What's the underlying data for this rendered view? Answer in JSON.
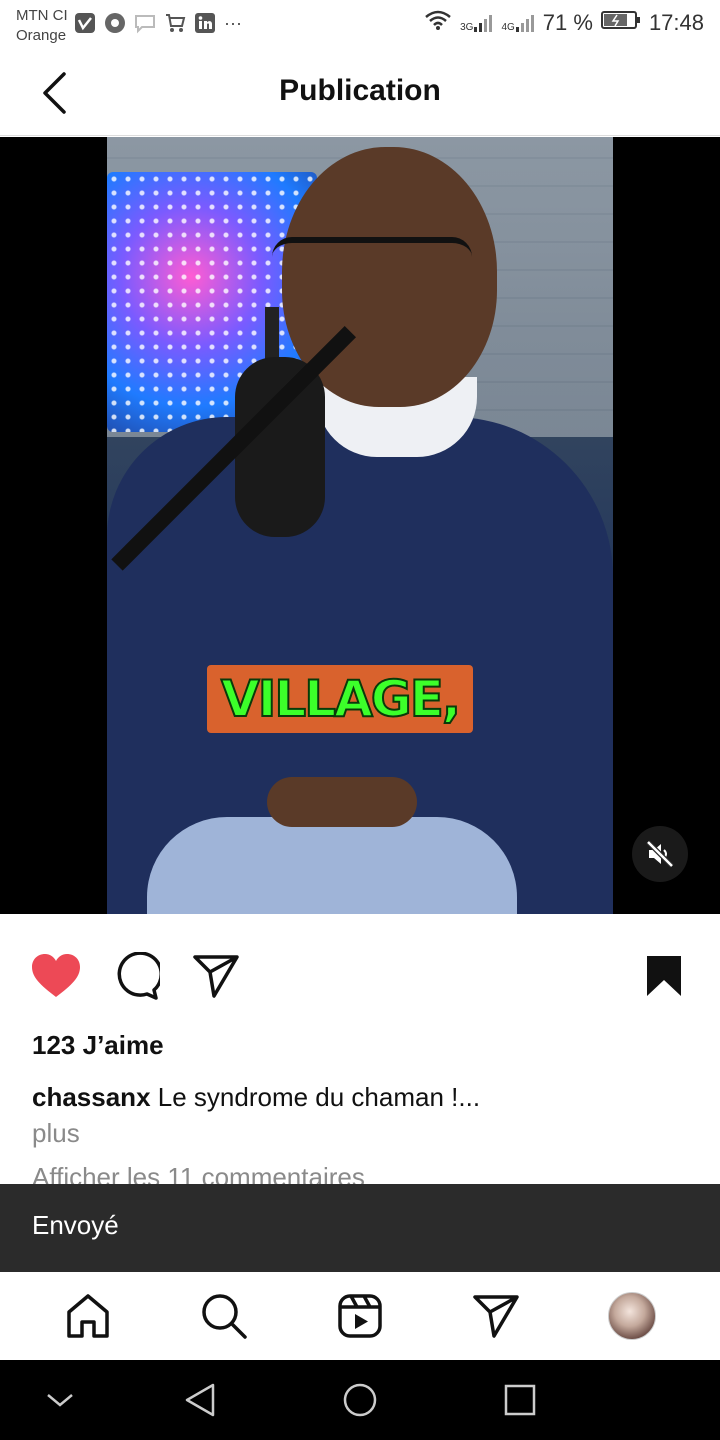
{
  "status_bar": {
    "carrier_line1": "MTN CI",
    "carrier_line2": "Orange",
    "more": "···",
    "net_3g": "3G",
    "net_4g": "4G",
    "battery": "71 %",
    "time": "17:48"
  },
  "header": {
    "title": "Publication"
  },
  "media": {
    "caption_overlay": "VILLAGE,"
  },
  "post": {
    "likes": "123 J’aime",
    "username": "chassanx",
    "caption": "Le syndrome du chaman !...",
    "more_label": "plus",
    "view_comments": "Afficher les 11 commentaires"
  },
  "toast": {
    "text": "Envoyé"
  },
  "colors": {
    "like_red": "#ed4956",
    "toast_bg": "#2b2b2b",
    "caption_box": "#d9622d",
    "caption_text": "#3cff2a"
  },
  "icons": {
    "back": "chevron-left-icon",
    "like": "heart-filled-icon",
    "comment": "comment-icon",
    "share": "send-icon",
    "save": "bookmark-filled-icon",
    "mute": "speaker-muted-icon",
    "home": "home-icon",
    "search": "search-icon",
    "reels": "reels-icon",
    "messages": "send-icon",
    "profile": "avatar"
  }
}
